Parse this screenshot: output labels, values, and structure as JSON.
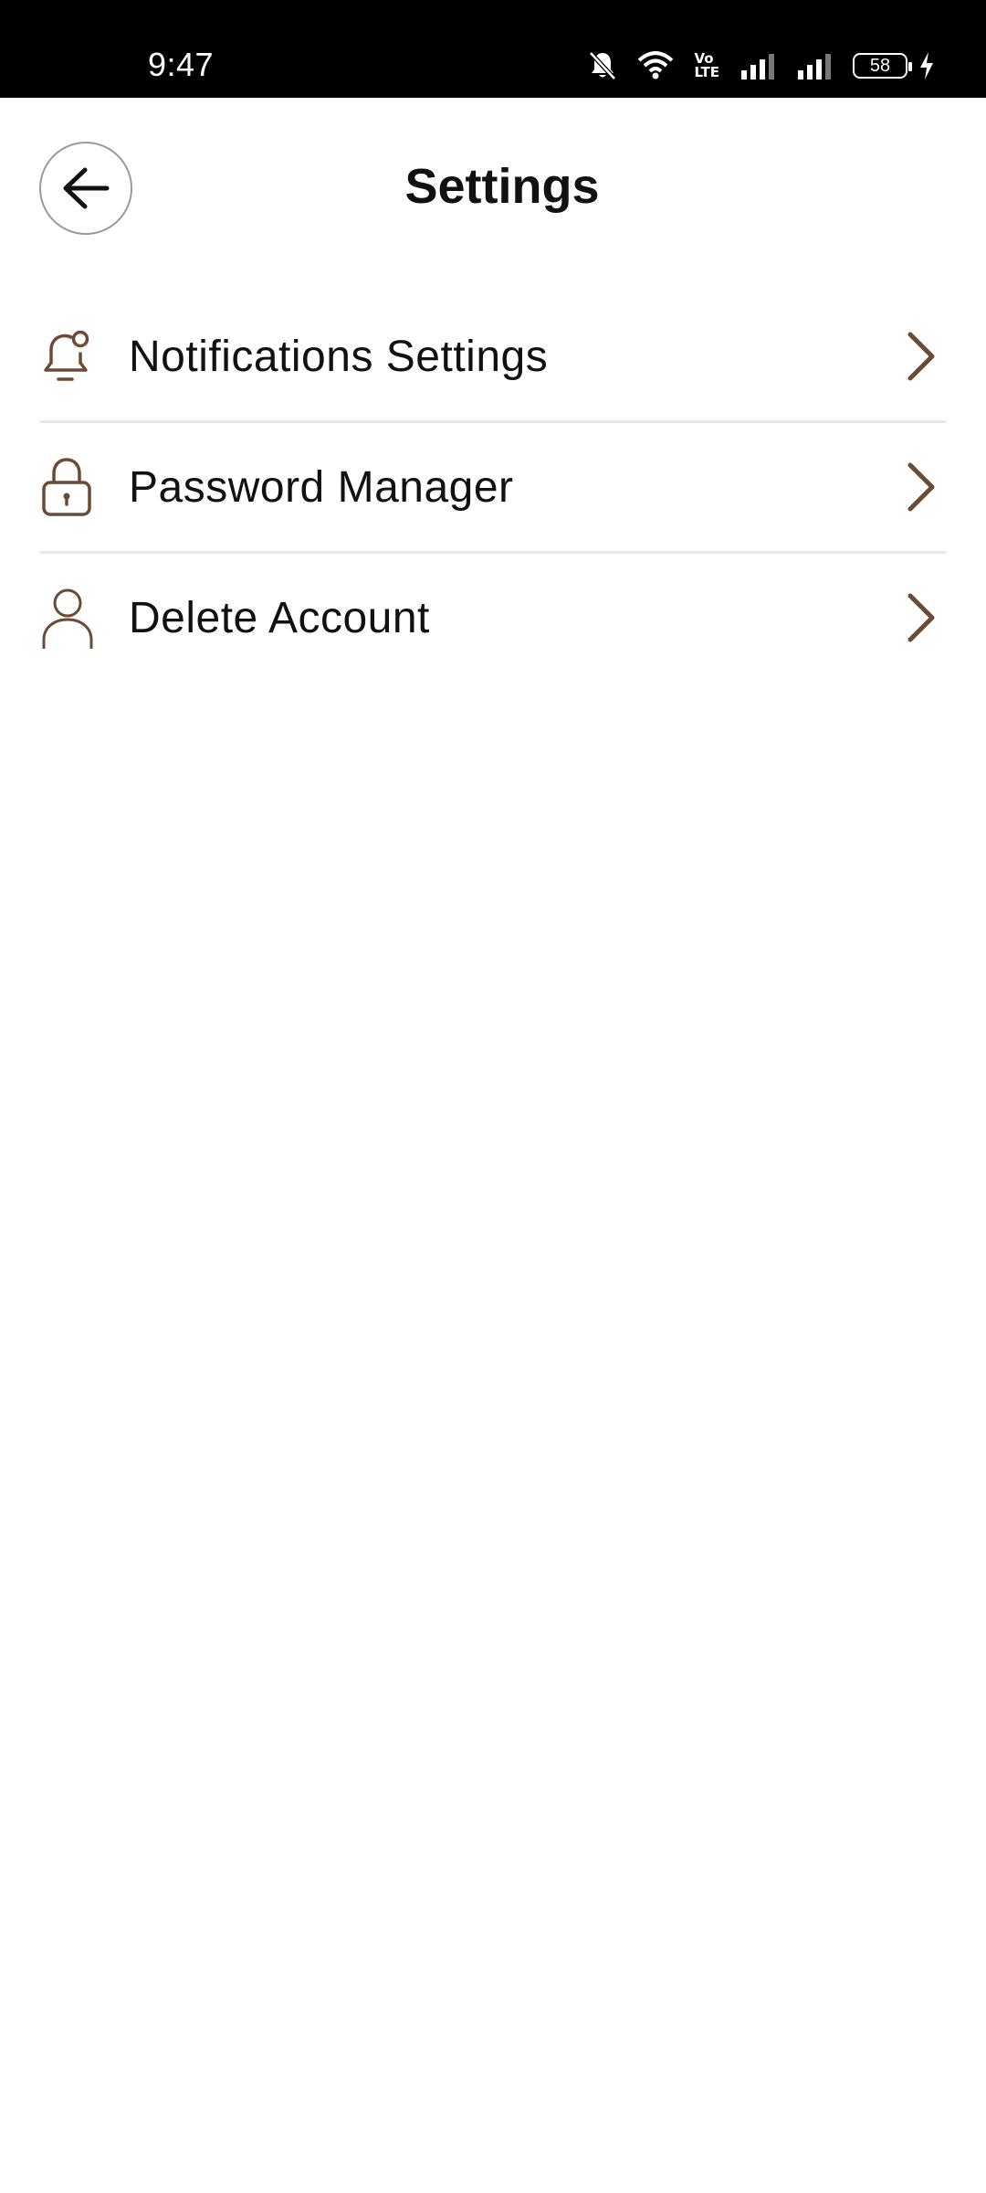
{
  "status_bar": {
    "time": "9:47",
    "icons": [
      "bell-off-icon",
      "wifi-icon",
      "volte-icon",
      "signal-icon",
      "signal-icon",
      "battery-icon",
      "charging-icon"
    ],
    "volte_label_top": "Vo",
    "volte_label_bottom": "LTE",
    "battery_level": "58"
  },
  "header": {
    "title": "Settings",
    "back_icon": "arrow-left-icon"
  },
  "settings": {
    "items": [
      {
        "label": "Notifications Settings",
        "icon": "bell-icon"
      },
      {
        "label": "Password Manager",
        "icon": "lock-icon"
      },
      {
        "label": "Delete Account",
        "icon": "person-icon"
      }
    ]
  },
  "colors": {
    "accent": "#6b4a38",
    "divider": "#e8e8e8",
    "text": "#111111",
    "status_bar": "#000000"
  }
}
